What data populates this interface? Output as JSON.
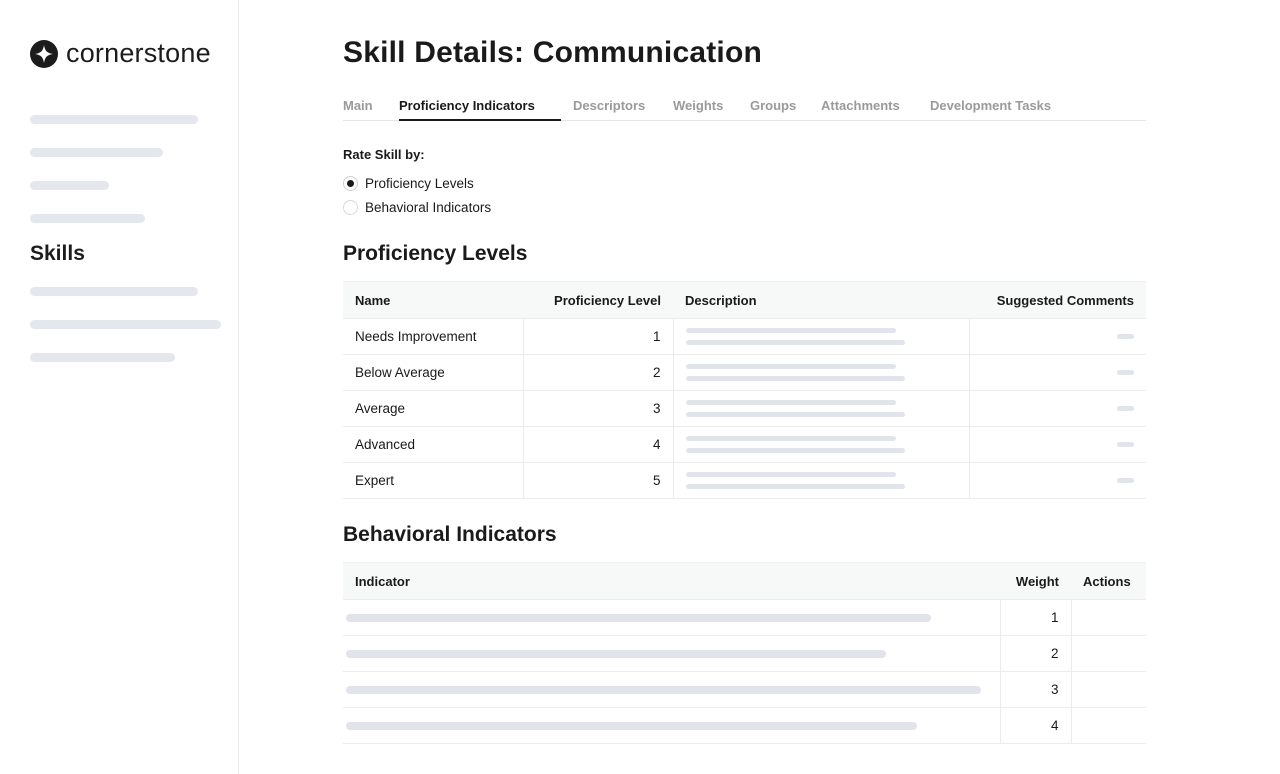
{
  "brand": {
    "name": "cornerstone"
  },
  "sidebar": {
    "skills_heading": "Skills"
  },
  "page": {
    "title": "Skill Details: Communication"
  },
  "tabs": [
    {
      "label": "Main",
      "active": false
    },
    {
      "label": "Proficiency Indicators",
      "active": true
    },
    {
      "label": "Descriptors",
      "active": false
    },
    {
      "label": "Weights",
      "active": false
    },
    {
      "label": "Groups",
      "active": false
    },
    {
      "label": "Attachments",
      "active": false
    },
    {
      "label": "Development Tasks",
      "active": false
    }
  ],
  "rate": {
    "label": "Rate Skill by:",
    "options": [
      {
        "label": "Proficiency Levels",
        "checked": true
      },
      {
        "label": "Behavioral Indicators",
        "checked": false
      }
    ]
  },
  "proficiency": {
    "title": "Proficiency Levels",
    "headers": {
      "name": "Name",
      "level": "Proficiency Level",
      "description": "Description",
      "comments": "Suggested Comments"
    },
    "rows": [
      {
        "name": "Needs Improvement",
        "level": "1"
      },
      {
        "name": "Below Average",
        "level": "2"
      },
      {
        "name": "Average",
        "level": "3"
      },
      {
        "name": "Advanced",
        "level": "4"
      },
      {
        "name": "Expert",
        "level": "5"
      }
    ]
  },
  "behavioral": {
    "title": "Behavioral Indicators",
    "headers": {
      "indicator": "Indicator",
      "weight": "Weight",
      "actions": "Actions"
    },
    "rows": [
      {
        "weight": "1"
      },
      {
        "weight": "2"
      },
      {
        "weight": "3"
      },
      {
        "weight": "4"
      }
    ]
  },
  "colors": {
    "text": "#1a1a1a",
    "muted": "#9a9a9a",
    "placeholder": "#e2e4ec",
    "header_bg": "#f7f8f8"
  }
}
